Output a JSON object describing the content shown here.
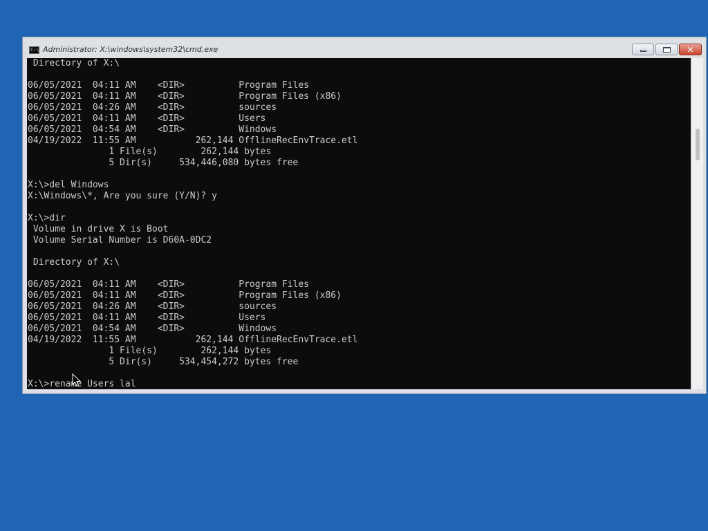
{
  "window": {
    "title": "Administrator: X:\\windows\\system32\\cmd.exe",
    "icon_label": "C:\\",
    "icon_name": "cmd-icon"
  },
  "caption_buttons": {
    "minimize_icon": "minimize-icon",
    "maximize_icon": "maximize-icon",
    "close_icon": "close-icon",
    "close_glyph": "✕"
  },
  "console": {
    "lines": [
      " Directory of X:\\",
      "",
      "06/05/2021  04:11 AM    <DIR>          Program Files",
      "06/05/2021  04:11 AM    <DIR>          Program Files (x86)",
      "06/05/2021  04:26 AM    <DIR>          sources",
      "06/05/2021  04:11 AM    <DIR>          Users",
      "06/05/2021  04:54 AM    <DIR>          Windows",
      "04/19/2022  11:55 AM           262,144 OfflineRecEnvTrace.etl",
      "               1 File(s)        262,144 bytes",
      "               5 Dir(s)     534,446,080 bytes free",
      "",
      "X:\\>del Windows",
      "X:\\Windows\\*, Are you sure (Y/N)? y",
      "",
      "X:\\>dir",
      " Volume in drive X is Boot",
      " Volume Serial Number is D60A-0DC2",
      "",
      " Directory of X:\\",
      "",
      "06/05/2021  04:11 AM    <DIR>          Program Files",
      "06/05/2021  04:11 AM    <DIR>          Program Files (x86)",
      "06/05/2021  04:26 AM    <DIR>          sources",
      "06/05/2021  04:11 AM    <DIR>          Users",
      "06/05/2021  04:54 AM    <DIR>          Windows",
      "04/19/2022  11:55 AM           262,144 OfflineRecEnvTrace.etl",
      "               1 File(s)        262,144 bytes",
      "               5 Dir(s)     534,454,272 bytes free",
      "",
      "X:\\>rename Users lal"
    ]
  },
  "colors": {
    "desktop": "#1f65b3",
    "console_bg": "#0c0c0c",
    "console_text": "#cccccc",
    "close_button": "#c8432b"
  }
}
